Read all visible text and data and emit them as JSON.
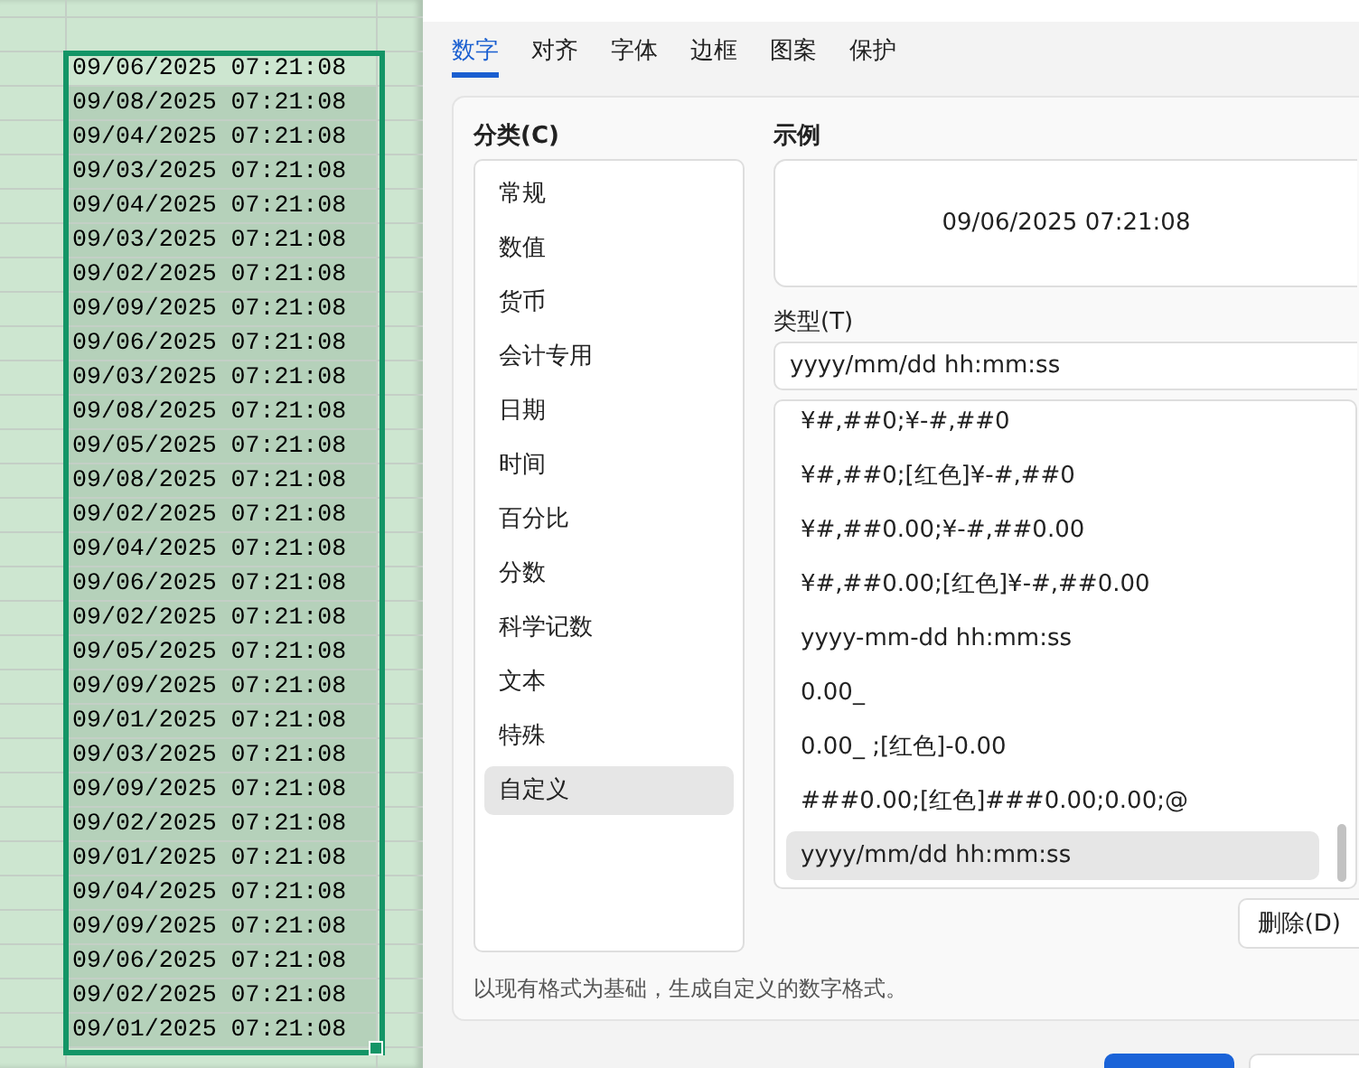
{
  "sheet": {
    "cells": [
      {
        "text": "09/06/2025 07:21:08",
        "active": true
      },
      {
        "text": "09/08/2025 07:21:08",
        "active": false
      },
      {
        "text": "09/04/2025 07:21:08",
        "active": false
      },
      {
        "text": "09/03/2025 07:21:08",
        "active": false
      },
      {
        "text": "09/04/2025 07:21:08",
        "active": false
      },
      {
        "text": "09/03/2025 07:21:08",
        "active": false
      },
      {
        "text": "09/02/2025 07:21:08",
        "active": false
      },
      {
        "text": "09/09/2025 07:21:08",
        "active": false
      },
      {
        "text": "09/06/2025 07:21:08",
        "active": false
      },
      {
        "text": "09/03/2025 07:21:08",
        "active": false
      },
      {
        "text": "09/08/2025 07:21:08",
        "active": false
      },
      {
        "text": "09/05/2025 07:21:08",
        "active": false
      },
      {
        "text": "09/08/2025 07:21:08",
        "active": false
      },
      {
        "text": "09/02/2025 07:21:08",
        "active": false
      },
      {
        "text": "09/04/2025 07:21:08",
        "active": false
      },
      {
        "text": "09/06/2025 07:21:08",
        "active": false
      },
      {
        "text": "09/02/2025 07:21:08",
        "active": false
      },
      {
        "text": "09/05/2025 07:21:08",
        "active": false
      },
      {
        "text": "09/09/2025 07:21:08",
        "active": false
      },
      {
        "text": "09/01/2025 07:21:08",
        "active": false
      },
      {
        "text": "09/03/2025 07:21:08",
        "active": false
      },
      {
        "text": "09/09/2025 07:21:08",
        "active": false
      },
      {
        "text": "09/02/2025 07:21:08",
        "active": false
      },
      {
        "text": "09/01/2025 07:21:08",
        "active": false
      },
      {
        "text": "09/04/2025 07:21:08",
        "active": false
      },
      {
        "text": "09/09/2025 07:21:08",
        "active": false
      },
      {
        "text": "09/06/2025 07:21:08",
        "active": false
      },
      {
        "text": "09/02/2025 07:21:08",
        "active": false
      },
      {
        "text": "09/01/2025 07:21:08",
        "active": false
      }
    ]
  },
  "dialog": {
    "tabs": [
      {
        "label": "数字",
        "selected": true
      },
      {
        "label": "对齐",
        "selected": false
      },
      {
        "label": "字体",
        "selected": false
      },
      {
        "label": "边框",
        "selected": false
      },
      {
        "label": "图案",
        "selected": false
      },
      {
        "label": "保护",
        "selected": false
      }
    ],
    "category_label": "分类(C)",
    "categories": [
      {
        "label": "常规",
        "selected": false
      },
      {
        "label": "数值",
        "selected": false
      },
      {
        "label": "货币",
        "selected": false
      },
      {
        "label": "会计专用",
        "selected": false
      },
      {
        "label": "日期",
        "selected": false
      },
      {
        "label": "时间",
        "selected": false
      },
      {
        "label": "百分比",
        "selected": false
      },
      {
        "label": "分数",
        "selected": false
      },
      {
        "label": "科学记数",
        "selected": false
      },
      {
        "label": "文本",
        "selected": false
      },
      {
        "label": "特殊",
        "selected": false
      },
      {
        "label": "自定义",
        "selected": true
      }
    ],
    "sample_label": "示例",
    "sample": "09/06/2025 07:21:08",
    "type_label": "类型(T)",
    "type_value": "yyyy/mm/dd hh:mm:ss",
    "formats": [
      {
        "label": "¥#,##0;¥-#,##0",
        "selected": false
      },
      {
        "label": "¥#,##0;[红色]¥-#,##0",
        "selected": false
      },
      {
        "label": "¥#,##0.00;¥-#,##0.00",
        "selected": false
      },
      {
        "label": "¥#,##0.00;[红色]¥-#,##0.00",
        "selected": false
      },
      {
        "label": "yyyy-mm-dd hh:mm:ss",
        "selected": false
      },
      {
        "label": "0.00_",
        "selected": false
      },
      {
        "label": "0.00_ ;[红色]-0.00",
        "selected": false
      },
      {
        "label": "###0.00;[红色]###0.00;0.00;@",
        "selected": false
      },
      {
        "label": "yyyy/mm/dd hh:mm:ss",
        "selected": true
      }
    ],
    "delete_button": "删除(D)",
    "hint": "以现有格式为基础，生成自定义的数字格式。"
  }
}
